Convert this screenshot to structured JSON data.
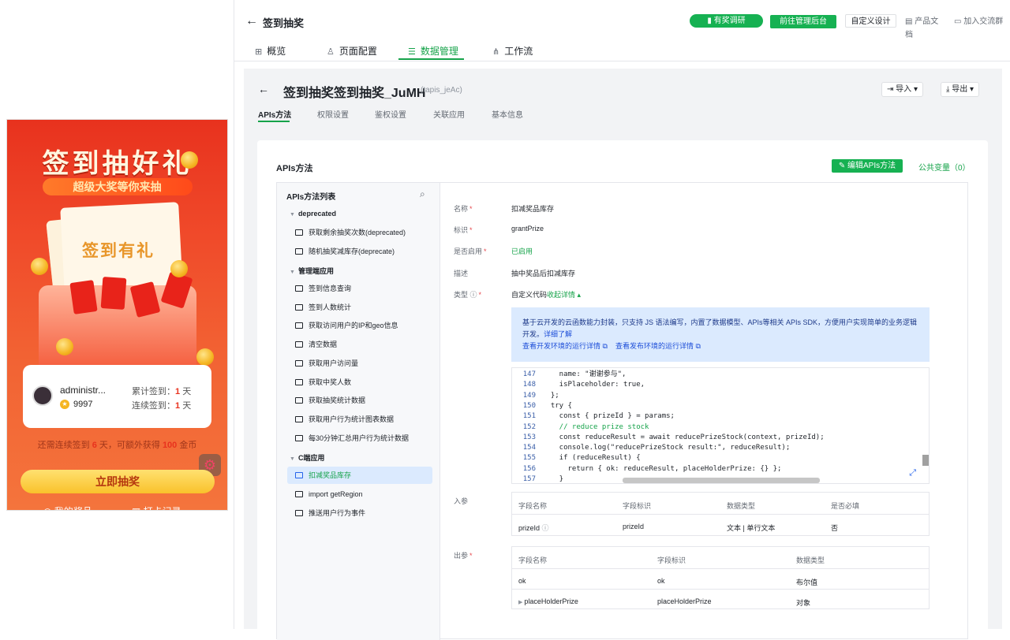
{
  "phone": {
    "title": "签到抽好礼",
    "subtitle": "超级大奖等你来抽",
    "card_label": "签到有礼",
    "username": "administr...",
    "points": "9997",
    "total_label": "累计签到：",
    "total_value": "1",
    "streak_label": "连续签到：",
    "streak_value": "1",
    "day_unit": "天",
    "note_pre": "还需连续签到",
    "note_days": "6",
    "note_mid": "天，可额外获得",
    "note_amount": "100",
    "note_post": "金币",
    "cta": "立即抽奖",
    "bottom_left": "◎ 我的奖品",
    "bottom_right": "▦ 打卡记录"
  },
  "topbar": {
    "title": "签到抽奖",
    "survey": "有奖调研",
    "goto_admin": "前往管理后台",
    "custom_design": "自定义设计",
    "docs": "产品文档",
    "community": "加入交流群"
  },
  "main_tabs": [
    {
      "label": "概览",
      "icon": "grid-icon"
    },
    {
      "label": "页面配置",
      "icon": "user-icon"
    },
    {
      "label": "数据管理",
      "icon": "database-icon"
    },
    {
      "label": "工作流",
      "icon": "workflow-icon"
    }
  ],
  "dataset": {
    "title": "签到抽奖签到抽奖_JuMH",
    "id": "(tapis_jeAc)",
    "import": "导入",
    "export": "导出"
  },
  "sub_tabs": [
    "APIs方法",
    "权限设置",
    "鉴权设置",
    "关联应用",
    "基本信息"
  ],
  "card": {
    "title": "APIs方法",
    "edit": "编辑APIs方法",
    "public_vars": "公共变量（0）"
  },
  "api_list": {
    "title": "APIs方法列表",
    "groups": [
      {
        "name": "deprecated",
        "items": [
          "获取剩余抽奖次数(deprecated)",
          "随机抽奖减库存(deprecate)"
        ]
      },
      {
        "name": "管理端应用",
        "items": [
          "签到信息查询",
          "签到人数统计",
          "获取访问用户的IP和geo信息",
          "清空数据",
          "获取用户访问量",
          "获取中奖人数",
          "获取抽奖统计数据",
          "获取用户行为统计图表数据",
          "每30分钟汇总用户行为统计数据"
        ]
      },
      {
        "name": "C端应用",
        "items": [
          "扣减奖品库存",
          "import getRegion",
          "推送用户行为事件"
        ]
      }
    ],
    "selected": "扣减奖品库存"
  },
  "detail": {
    "name_label": "名称",
    "name": "扣减奖品库存",
    "ident_label": "标识",
    "ident": "grantPrize",
    "enabled_label": "是否启用",
    "enabled": "已启用",
    "desc_label": "描述",
    "desc": "抽中奖品后扣减库存",
    "type_label": "类型",
    "type": "自定义代码",
    "collapse": "收起详情",
    "info_text": "基于云开发的云函数能力封装，只支持 JS 语法编写，内置了数据模型、APIs等相关 APIs SDK，方便用户实现简单的业务逻辑开发。",
    "info_more": "详细了解",
    "info_dev_log": "查看开发环境的运行详情",
    "info_prod_log": "查看发布环境的运行详情",
    "params_label": "入参",
    "params_headers": [
      "字段名称",
      "字段标识",
      "数据类型",
      "是否必填"
    ],
    "params_rows": [
      [
        "prizeId",
        "prizeId",
        "文本 | 单行文本",
        "否"
      ]
    ],
    "output_label": "出参",
    "output_headers": [
      "字段名称",
      "字段标识",
      "数据类型"
    ],
    "output_rows": [
      [
        "ok",
        "ok",
        "布尔值"
      ],
      [
        "placeHolderPrize",
        "placeHolderPrize",
        "对象"
      ]
    ]
  },
  "code_lines": [
    {
      "n": "147",
      "t": "    name: \"谢谢参与\","
    },
    {
      "n": "148",
      "t": "    isPlaceholder: true,"
    },
    {
      "n": "149",
      "t": "  };"
    },
    {
      "n": "150",
      "t": "  try {"
    },
    {
      "n": "151",
      "t": "    const { prizeId } = params;"
    },
    {
      "n": "152",
      "t": "    // reduce prize stock"
    },
    {
      "n": "153",
      "t": "    const reduceResult = await reducePrizeStock(context, prizeId);"
    },
    {
      "n": "154",
      "t": "    console.log(\"reducePrizeStock result:\", reduceResult);"
    },
    {
      "n": "155",
      "t": "    if (reduceResult) {"
    },
    {
      "n": "156",
      "t": "      return { ok: reduceResult, placeHolderPrize: {} };"
    },
    {
      "n": "157",
      "t": "    }"
    }
  ],
  "colors": {
    "accent": "#16a34a",
    "button": "#16b152",
    "info_bg": "#dbeafe"
  }
}
